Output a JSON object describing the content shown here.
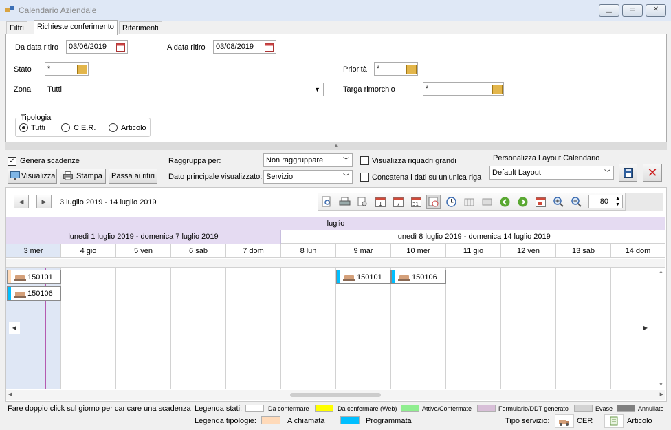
{
  "window": {
    "title": "Calendario Aziendale"
  },
  "tabs": [
    "Filtri",
    "Richieste conferimento",
    "Riferimenti"
  ],
  "filters": {
    "from_label": "Da data ritiro",
    "from_value": "03/06/2019",
    "to_label": "A data ritiro",
    "to_value": "03/08/2019",
    "stato_label": "Stato",
    "stato_value": "*",
    "priorita_label": "Priorità",
    "priorita_value": "*",
    "zona_label": "Zona",
    "zona_value": "Tutti",
    "targa_label": "Targa rimorchio",
    "targa_value": "*",
    "tipologia_label": "Tipologia",
    "tipologia_options": [
      "Tutti",
      "C.E.R.",
      "Articolo"
    ]
  },
  "controls": {
    "genera_label": "Genera scadenze",
    "visualizza_label": "Visualizza",
    "stampa_label": "Stampa",
    "passa_label": "Passa ai ritiri",
    "raggruppa_label": "Raggruppa per:",
    "raggruppa_value": "Non raggruppare",
    "dato_label": "Dato principale visualizzato:",
    "dato_value": "Servizio",
    "riquadri_label": "Visualizza riquadri grandi",
    "concatena_label": "Concatena i dati su un'unica riga",
    "layout_title": "Personalizza Layout Calendario",
    "layout_value": "Default Layout"
  },
  "calendar": {
    "range": "3 luglio 2019 - 14 luglio 2019",
    "zoom": "80",
    "month": "luglio",
    "weeks": [
      "lunedì 1 luglio 2019 - domenica 7 luglio 2019",
      "lunedì 8 luglio 2019 - domenica 14 luglio 2019"
    ],
    "days": [
      "3 mer",
      "4 gio",
      "5 ven",
      "6 sab",
      "7 dom",
      "8 lun",
      "9 mar",
      "10 mer",
      "11 gio",
      "12 ven",
      "13 sab",
      "14 dom"
    ],
    "events": [
      "150101",
      "150106",
      "150101",
      "150106"
    ]
  },
  "footer": {
    "hint": "Fare doppio click sul giorno per caricare una scadenza",
    "legenda_stati": "Legenda stati:",
    "stati": [
      {
        "label": "Da confermare",
        "color": "#ffffff"
      },
      {
        "label": "Da confermare (Web)",
        "color": "#ffff00"
      },
      {
        "label": "Attive/Confermate",
        "color": "#90ee90"
      },
      {
        "label": "Formulario/DDT generato",
        "color": "#d8bfd8"
      },
      {
        "label": "Evase",
        "color": "#d3d3d3"
      },
      {
        "label": "Annullate",
        "color": "#808080"
      }
    ],
    "legenda_tipologie": "Legenda tipologie:",
    "tipologie": [
      {
        "label": "A chiamata",
        "color": "#ffdab9"
      },
      {
        "label": "Programmata",
        "color": "#00bfff"
      }
    ],
    "tipo_servizio": "Tipo servizio:",
    "servizi": [
      "CER",
      "Articolo"
    ]
  }
}
